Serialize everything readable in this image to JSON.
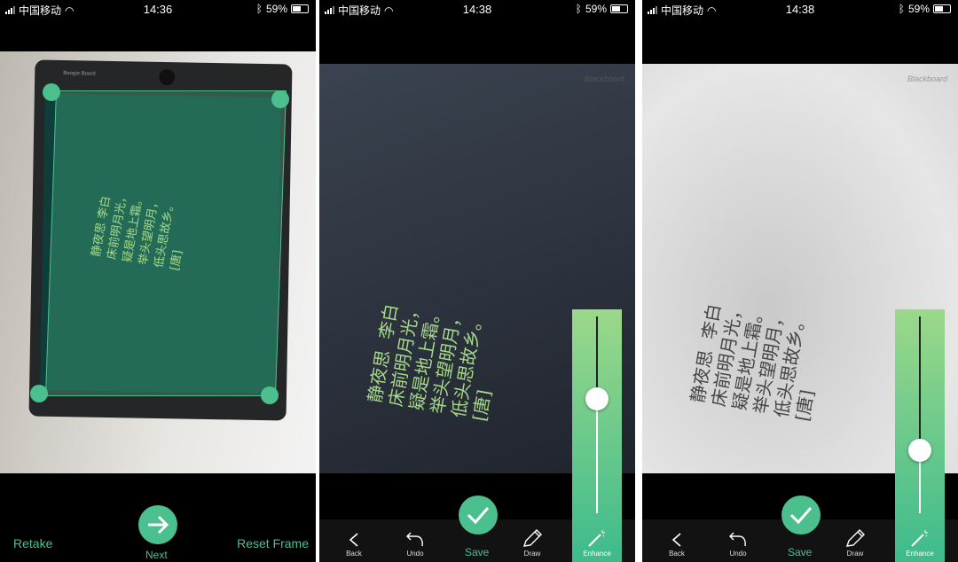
{
  "poem": {
    "title": "静夜思",
    "author": "李白",
    "dynasty": "[唐]",
    "lines": [
      "床前明月光，",
      "疑是地上霜。",
      "举头望明月，",
      "低头思故乡。"
    ]
  },
  "screens": [
    {
      "status": {
        "carrier": "中国移动",
        "time": "14:36",
        "battery": "59%"
      },
      "board_brand": "Boogie Board",
      "buttons": {
        "left": "Retake",
        "center": "Next",
        "right": "Reset Frame"
      }
    },
    {
      "status": {
        "carrier": "中国移动",
        "time": "14:38",
        "battery": "59%"
      },
      "watermark": "Blackboard",
      "toolbar": {
        "back": "Back",
        "undo": "Undo",
        "save": "Save",
        "draw": "Draw",
        "enhance": "Enhance"
      },
      "enhance_level": 0.58
    },
    {
      "status": {
        "carrier": "中国移动",
        "time": "14:38",
        "battery": "59%"
      },
      "watermark": "Blackboard",
      "toolbar": {
        "back": "Back",
        "undo": "Undo",
        "save": "Save",
        "draw": "Draw",
        "enhance": "Enhance"
      },
      "enhance_level": 0.32
    }
  ],
  "colors": {
    "accent": "#4cbf8e",
    "background": "#000000"
  }
}
